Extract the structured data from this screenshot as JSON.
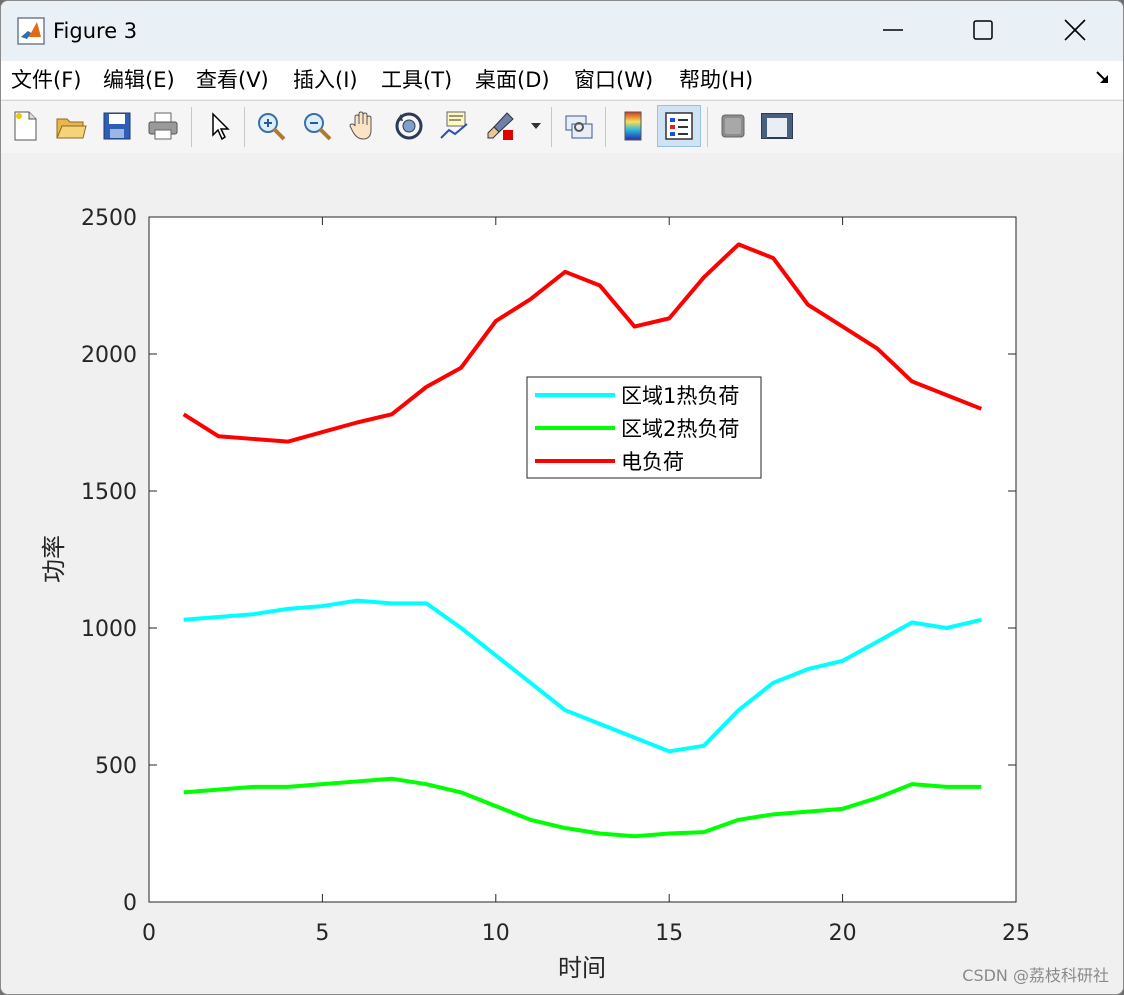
{
  "window": {
    "title": "Figure 3",
    "controls": [
      "minimize",
      "maximize",
      "close"
    ]
  },
  "menu": {
    "items": [
      "文件(F)",
      "编辑(E)",
      "查看(V)",
      "插入(I)",
      "工具(T)",
      "桌面(D)",
      "窗口(W)",
      "帮助(H)"
    ]
  },
  "toolbar": {
    "icons": [
      "new-figure-icon",
      "open-file-icon",
      "save-icon",
      "print-icon",
      "select-arrow-icon",
      "zoom-in-icon",
      "zoom-out-icon",
      "pan-hand-icon",
      "rotate-3d-icon",
      "data-cursor-icon",
      "brush-icon",
      "brush-dropdown-icon",
      "link-plot-icon",
      "colorbar-icon",
      "legend-icon",
      "hide-plot-tools-icon",
      "show-plot-tools-icon"
    ],
    "active": "legend-icon"
  },
  "chart_data": {
    "type": "line",
    "xlabel": "时间",
    "ylabel": "功率",
    "xlim": [
      0,
      25
    ],
    "ylim": [
      0,
      2500
    ],
    "xticks": [
      "0",
      "5",
      "10",
      "15",
      "20",
      "25"
    ],
    "yticks": [
      "0",
      "500",
      "1000",
      "1500",
      "2000",
      "2500"
    ],
    "xtick_values": [
      0,
      5,
      10,
      15,
      20,
      25
    ],
    "ytick_values": [
      0,
      500,
      1000,
      1500,
      2000,
      2500
    ],
    "grid": false,
    "legend_position": "upper-center",
    "x": [
      1,
      2,
      3,
      4,
      5,
      6,
      7,
      8,
      9,
      10,
      11,
      12,
      13,
      14,
      15,
      16,
      17,
      18,
      19,
      20,
      21,
      22,
      23,
      24
    ],
    "series": [
      {
        "name": "区域1热负荷",
        "color": "#00ffff",
        "values": [
          1030,
          1040,
          1050,
          1070,
          1080,
          1100,
          1090,
          1090,
          1000,
          900,
          800,
          700,
          650,
          600,
          550,
          570,
          700,
          800,
          850,
          880,
          950,
          1020,
          1000,
          1030
        ]
      },
      {
        "name": "区域2热负荷",
        "color": "#00ff00",
        "values": [
          400,
          410,
          420,
          420,
          430,
          440,
          450,
          430,
          400,
          350,
          300,
          270,
          250,
          240,
          250,
          255,
          300,
          320,
          330,
          340,
          380,
          430,
          420,
          420
        ]
      },
      {
        "name": "电负荷",
        "color": "#ff0000",
        "values": [
          1780,
          1700,
          1690,
          1680,
          1715,
          1750,
          1780,
          1880,
          1950,
          2120,
          2200,
          2300,
          2250,
          2100,
          2130,
          2280,
          2400,
          2350,
          2180,
          2100,
          2020,
          1900,
          1850,
          1800
        ]
      }
    ]
  },
  "watermark": "CSDN @荔枝科研社"
}
